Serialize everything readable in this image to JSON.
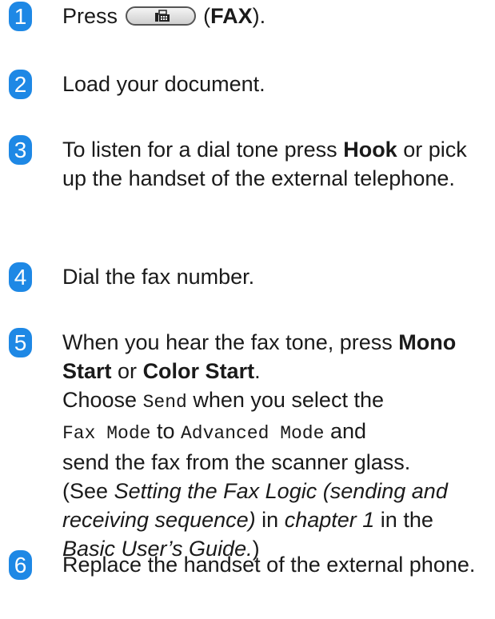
{
  "accent_color": "#1e88e5",
  "icons": {
    "fax_button": "fax-machine-icon"
  },
  "steps": [
    {
      "number": "1",
      "press": "Press",
      "open_paren": "(",
      "fax": "FAX",
      "close": ")."
    },
    {
      "number": "2",
      "text": "Load your document."
    },
    {
      "number": "3",
      "pre": "To listen for a dial tone press",
      "hook": "Hook",
      "post": "or pick up the handset of the external telephone."
    },
    {
      "number": "4",
      "text": "Dial the fax number."
    },
    {
      "number": "5",
      "pre": "When you hear the fax tone, press",
      "mono_start": "Mono Start",
      "or": "or",
      "color_start": "Color Start",
      "period": ".",
      "choose": "Choose",
      "send": "Send",
      "when_select": "when you select the",
      "fax_mode": "Fax Mode",
      "to": "to",
      "advanced_mode": "Advanced Mode",
      "and": "and",
      "send_from": "send the fax from the scanner glass.",
      "see_open": "(See",
      "setting_title": "Setting the Fax Logic (sending and receiving sequence)",
      "in1": "in",
      "chapter": "chapter 1",
      "in_the": "in the",
      "guide": "Basic User’s Guide.",
      "see_close": ")"
    },
    {
      "number": "6",
      "text": "Replace the handset of the external phone."
    }
  ]
}
